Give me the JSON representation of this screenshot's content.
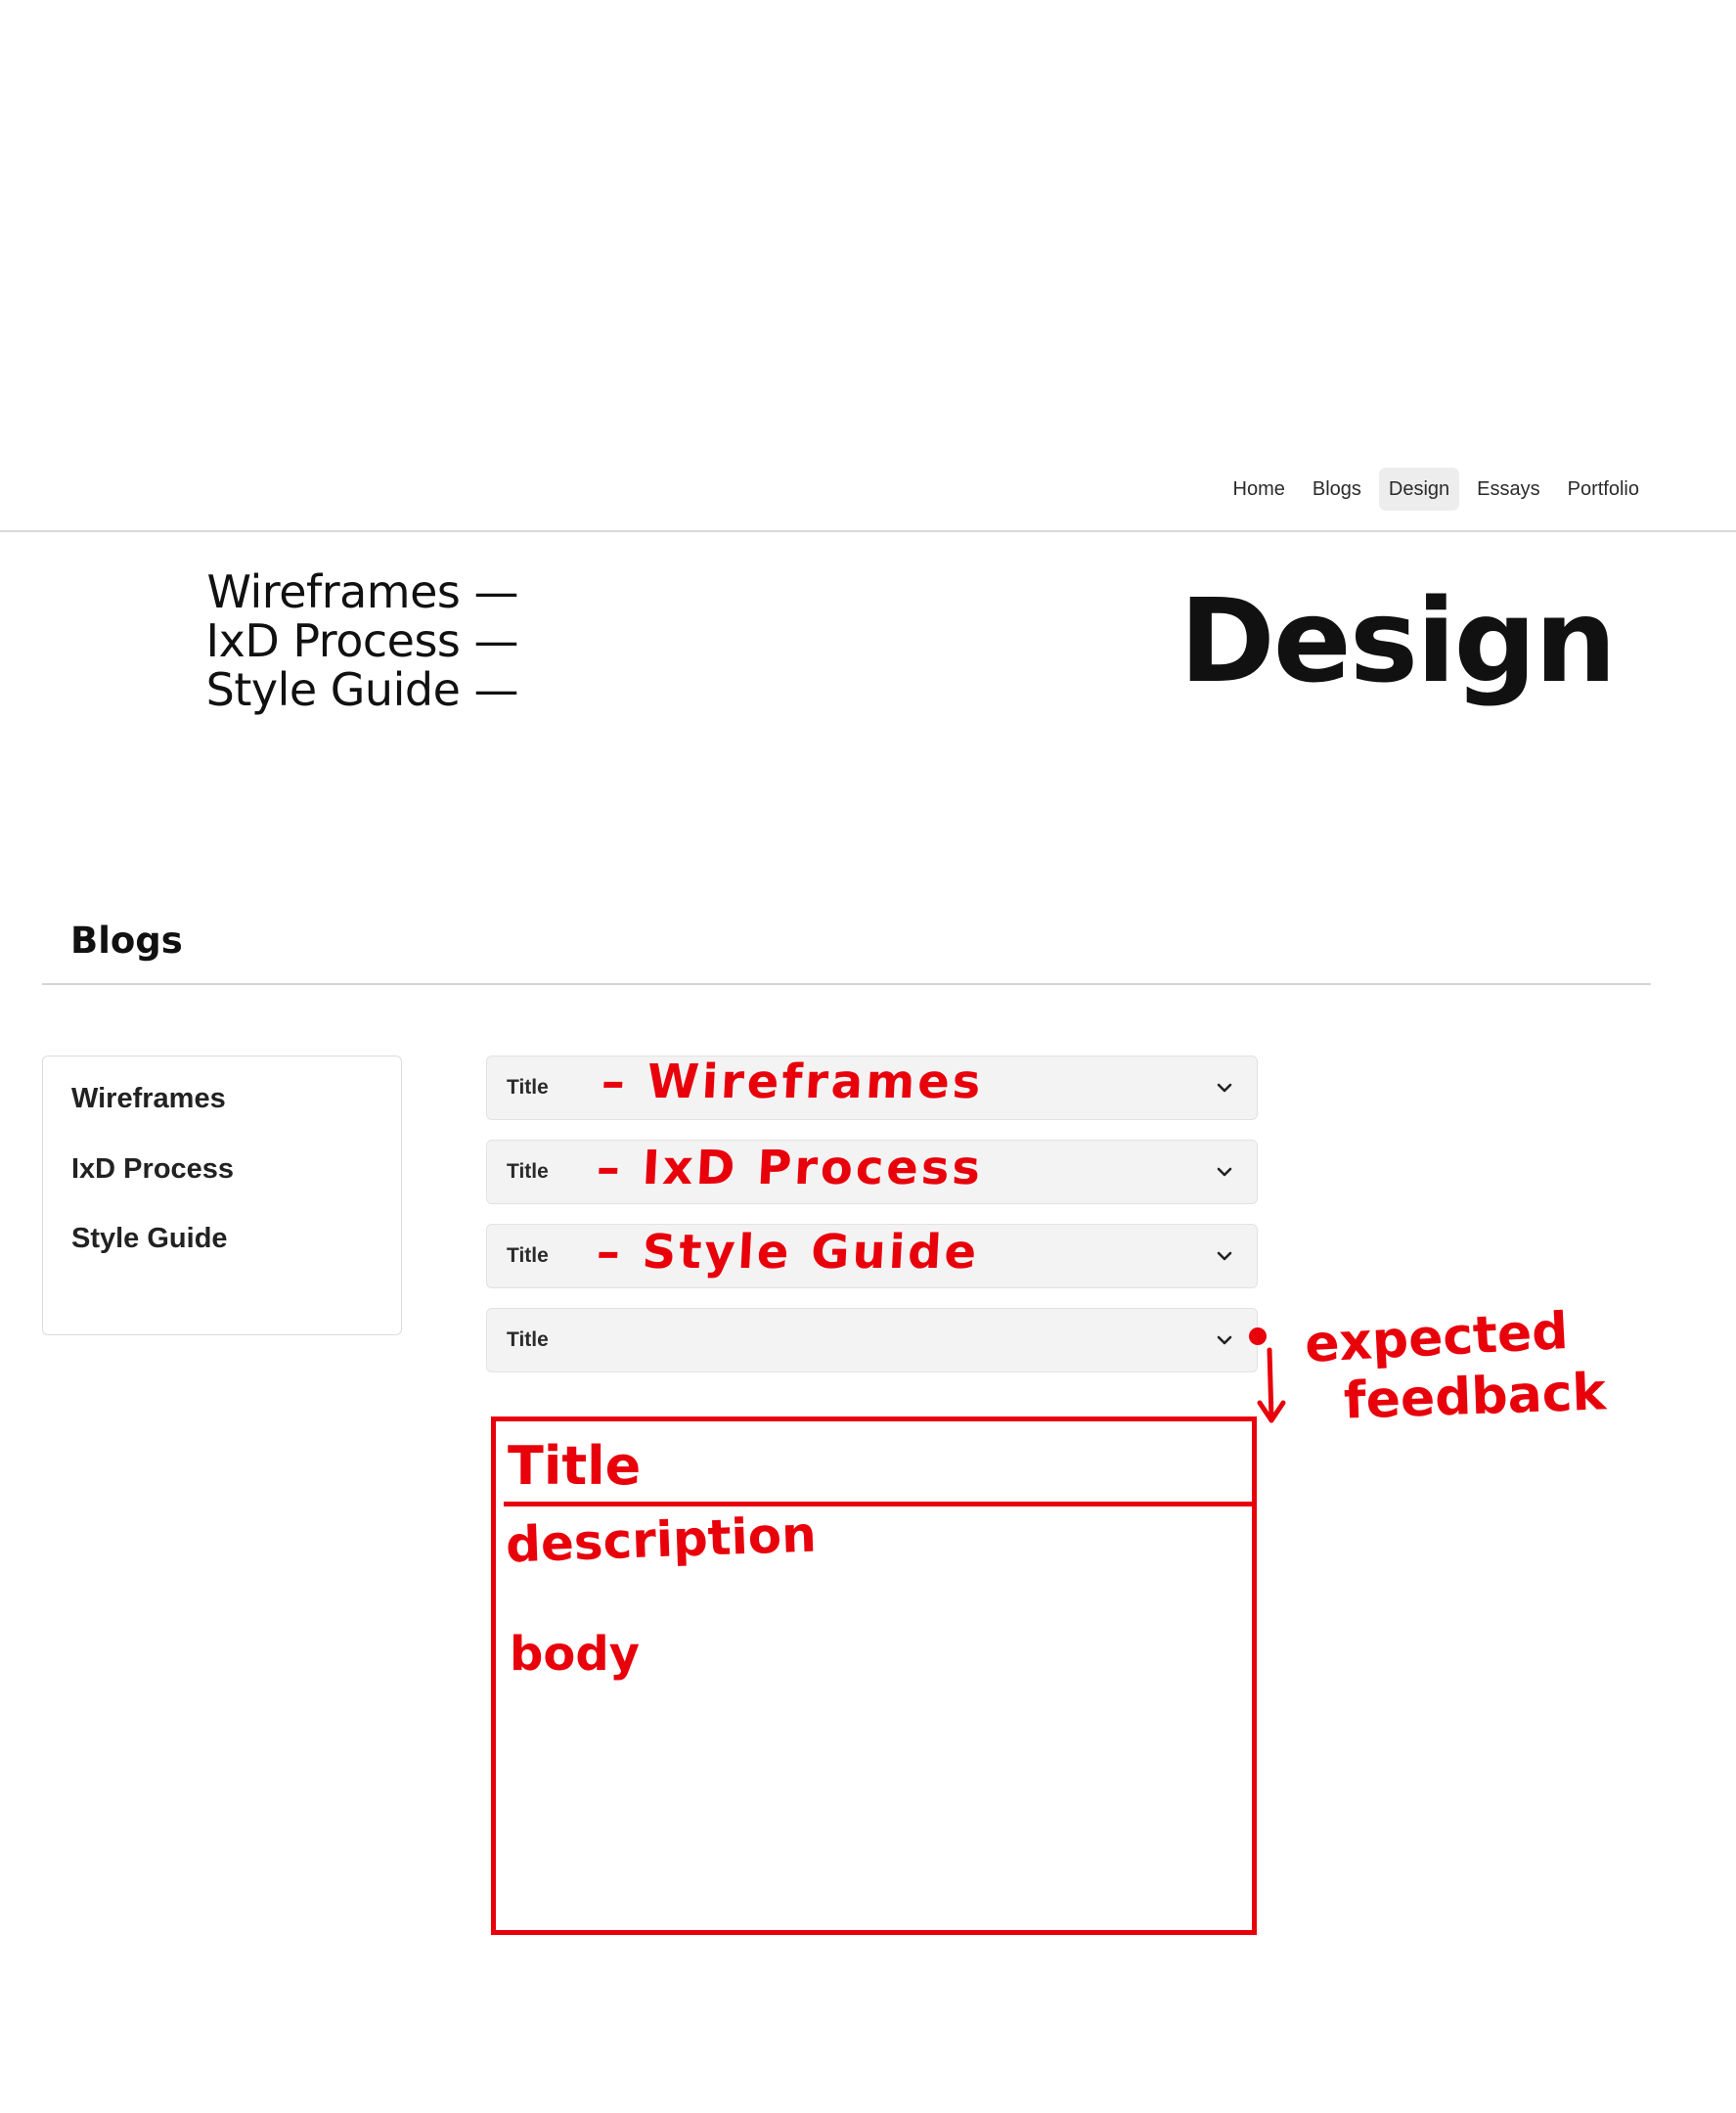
{
  "nav": {
    "items": [
      "Home",
      "Blogs",
      "Design",
      "Essays",
      "Portfolio"
    ],
    "active": "Design"
  },
  "hero": {
    "list": [
      "Wireframes —",
      "IxD Process —",
      "Style Guide —"
    ],
    "title": "Design"
  },
  "blogs": {
    "heading": "Blogs",
    "sidebar": [
      "Wireframes",
      "IxD Process",
      "Style Guide"
    ],
    "accordions": [
      {
        "label": "Title",
        "note": "– Wireframes"
      },
      {
        "label": "Title",
        "note": "– IxD Process"
      },
      {
        "label": "Title",
        "note": "– Style Guide"
      },
      {
        "label": "Title",
        "note": ""
      }
    ]
  },
  "annotation": {
    "expected_1": "expected",
    "expected_2": "feedback",
    "box_title": "Title",
    "box_description": "description",
    "box_body": "body",
    "color": "#e8000b"
  }
}
